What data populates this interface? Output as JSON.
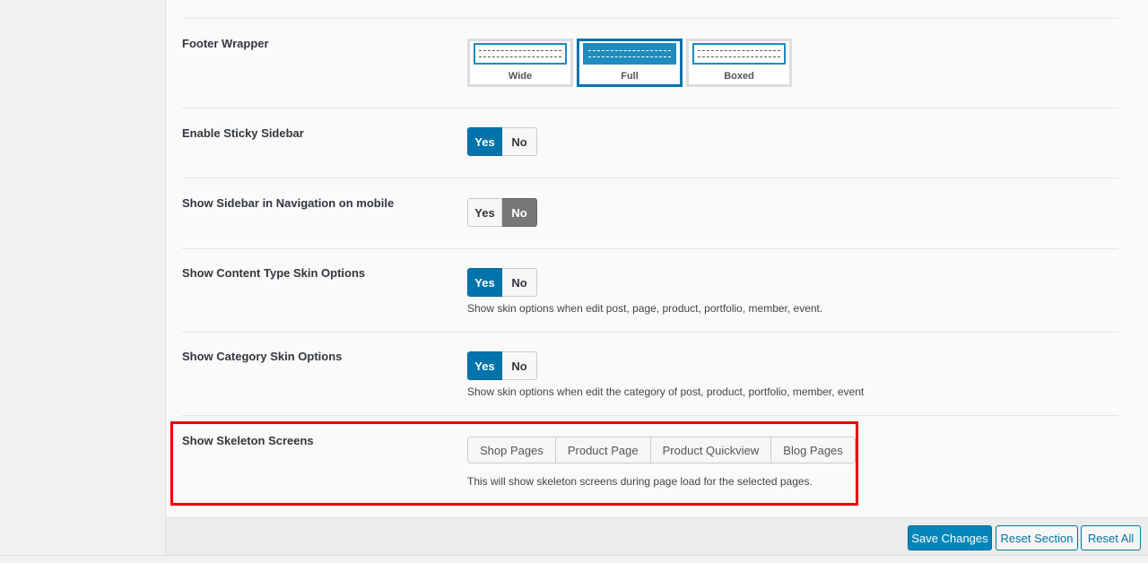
{
  "footer_wrapper": {
    "label": "Footer Wrapper",
    "options": [
      {
        "label": "Wide",
        "selected": false
      },
      {
        "label": "Full",
        "selected": true
      },
      {
        "label": "Boxed",
        "selected": false
      }
    ]
  },
  "sticky_sidebar": {
    "label": "Enable Sticky Sidebar",
    "yes": "Yes",
    "no": "No",
    "value": "Yes"
  },
  "sidebar_nav_mobile": {
    "label": "Show Sidebar in Navigation on mobile",
    "yes": "Yes",
    "no": "No",
    "value": "No"
  },
  "content_type_skin": {
    "label": "Show Content Type Skin Options",
    "yes": "Yes",
    "no": "No",
    "value": "Yes",
    "description": "Show skin options when edit post, page, product, portfolio, member, event."
  },
  "category_skin": {
    "label": "Show Category Skin Options",
    "yes": "Yes",
    "no": "No",
    "value": "Yes",
    "description": "Show skin options when edit the category of post, product, portfolio, member, event"
  },
  "skeleton_screens": {
    "label": "Show Skeleton Screens",
    "options": [
      "Shop Pages",
      "Product Page",
      "Product Quickview",
      "Blog Pages"
    ],
    "description": "This will show skeleton screens during page load for the selected pages."
  },
  "footer_buttons": {
    "save": "Save Changes",
    "reset_section": "Reset Section",
    "reset_all": "Reset All"
  },
  "colors": {
    "accent": "#0073aa",
    "highlight": "#ee0000"
  }
}
